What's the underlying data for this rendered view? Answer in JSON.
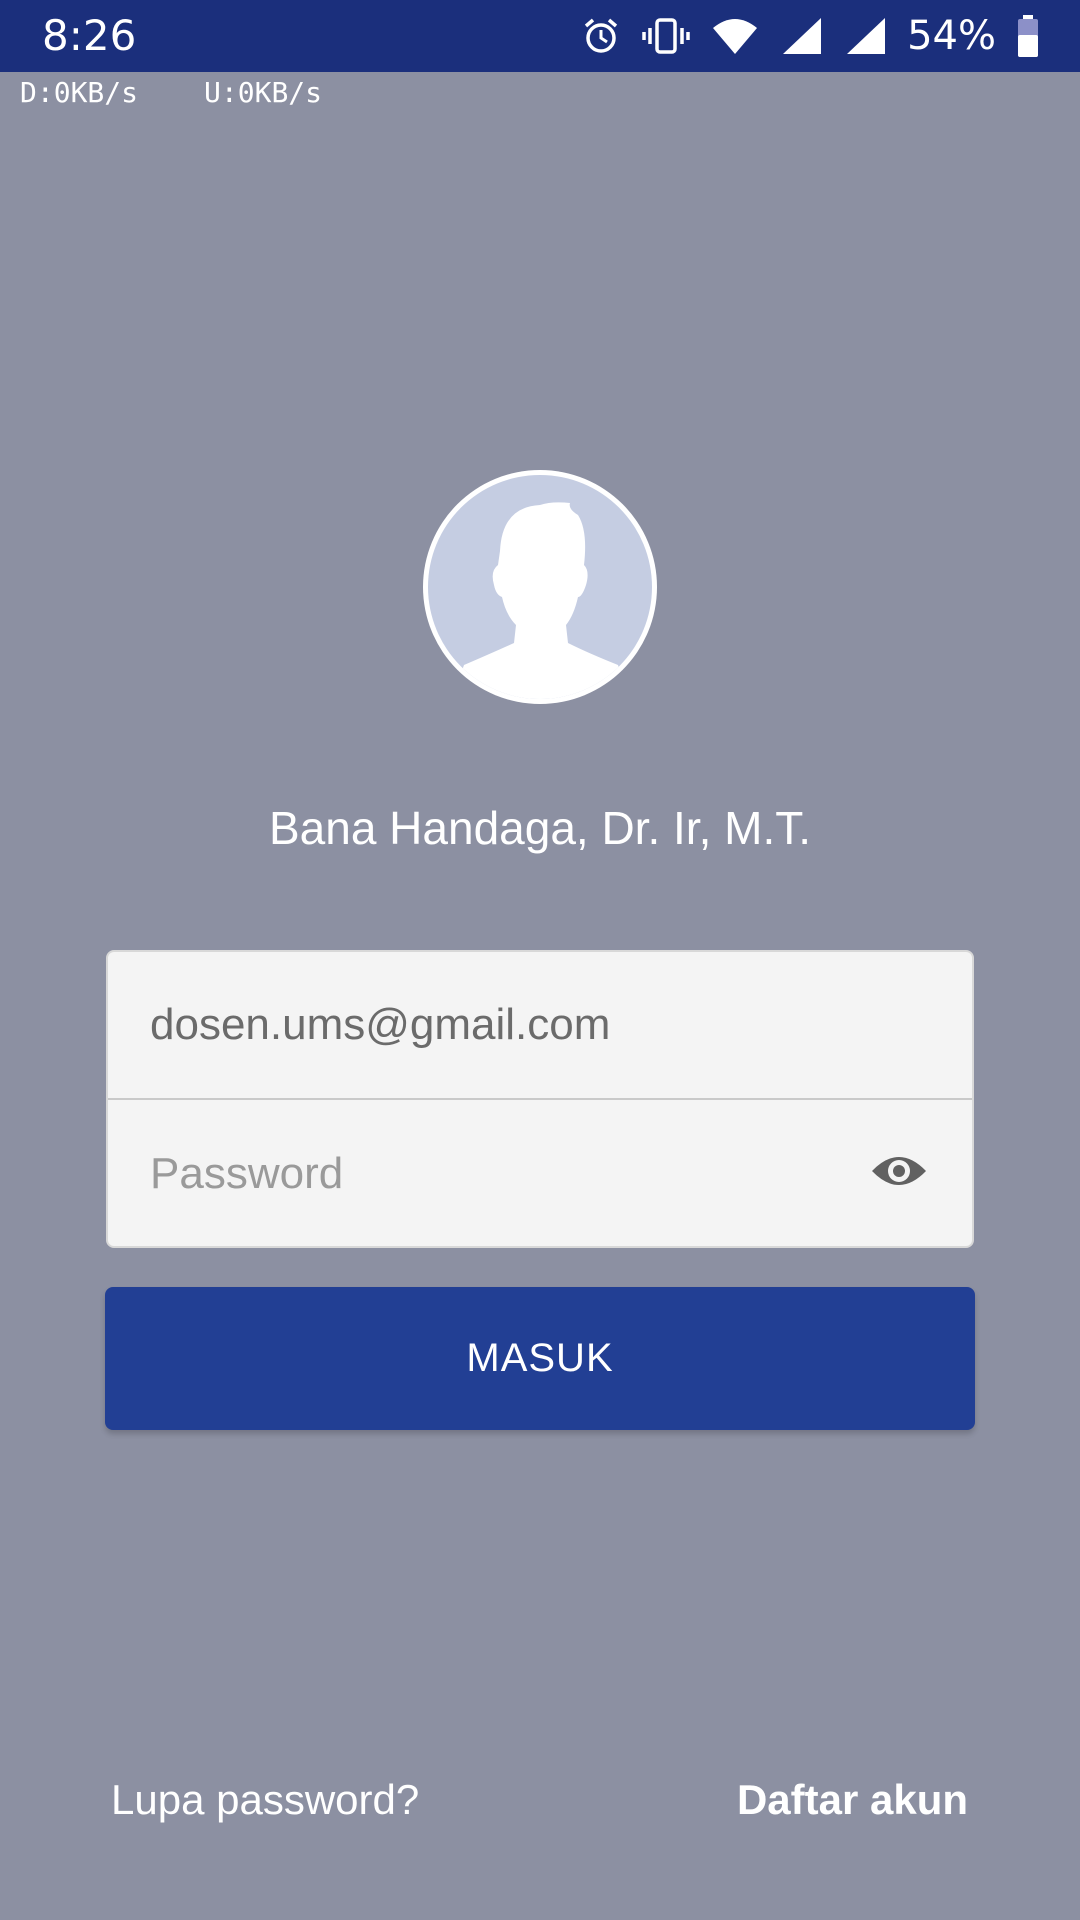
{
  "status_bar": {
    "time": "8:26",
    "battery_percent": "54%",
    "icons": [
      "alarm-icon",
      "vibrate-icon",
      "wifi-icon",
      "signal-icon",
      "signal-icon",
      "battery-icon"
    ],
    "background_color": "#1b2f7c"
  },
  "net_speed": {
    "download": "D:0KB/s",
    "upload": "U:0KB/s"
  },
  "profile": {
    "name": "Bana Handaga, Dr. Ir, M.T.",
    "avatar_icon": "user-silhouette-icon"
  },
  "form": {
    "email_value": "dosen.ums@gmail.com",
    "password_placeholder": "Password",
    "show_password_icon": "eye-icon"
  },
  "actions": {
    "login_label": "MASUK",
    "forgot_label": "Lupa password?",
    "register_label": "Daftar akun"
  },
  "colors": {
    "background": "#8c90a2",
    "primary": "#223f94"
  }
}
